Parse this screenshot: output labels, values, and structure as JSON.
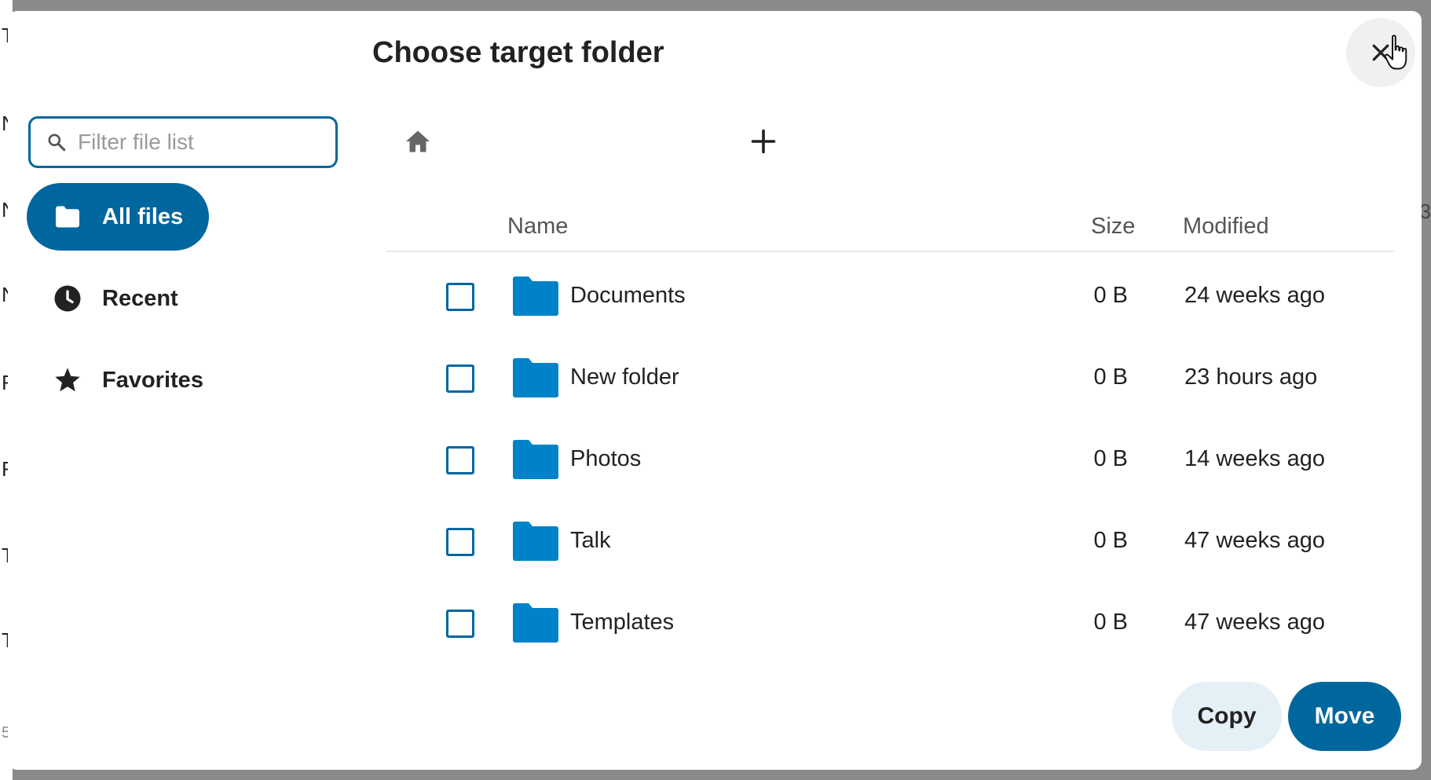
{
  "backdrop": {
    "left_letters": [
      "T",
      "N",
      "N",
      "N",
      "F",
      "F",
      "T",
      "T",
      "5"
    ],
    "right_char": "3"
  },
  "dialog": {
    "title": "Choose target folder",
    "close_icon": "close-icon"
  },
  "search": {
    "placeholder": "Filter file list",
    "value": "",
    "icon": "search-icon"
  },
  "sidebar": {
    "items": [
      {
        "label": "All files",
        "icon": "folder-icon",
        "active": true
      },
      {
        "label": "Recent",
        "icon": "clock-icon",
        "active": false
      },
      {
        "label": "Favorites",
        "icon": "star-icon",
        "active": false
      }
    ]
  },
  "breadcrumb": {
    "home_icon": "home-icon",
    "add_icon": "plus-icon"
  },
  "table": {
    "columns": [
      "Name",
      "Size",
      "Modified"
    ],
    "rows": [
      {
        "name": "Documents",
        "size": "0 B",
        "modified": "24 weeks ago"
      },
      {
        "name": "New folder",
        "size": "0 B",
        "modified": "23 hours ago"
      },
      {
        "name": "Photos",
        "size": "0 B",
        "modified": "14 weeks ago"
      },
      {
        "name": "Talk",
        "size": "0 B",
        "modified": "47 weeks ago"
      },
      {
        "name": "Templates",
        "size": "0 B",
        "modified": "47 weeks ago"
      }
    ]
  },
  "actions": {
    "copy_label": "Copy",
    "move_label": "Move"
  },
  "colors": {
    "primary": "#00679e",
    "folder": "#0082c9",
    "secondary_button": "#e5eff6"
  }
}
